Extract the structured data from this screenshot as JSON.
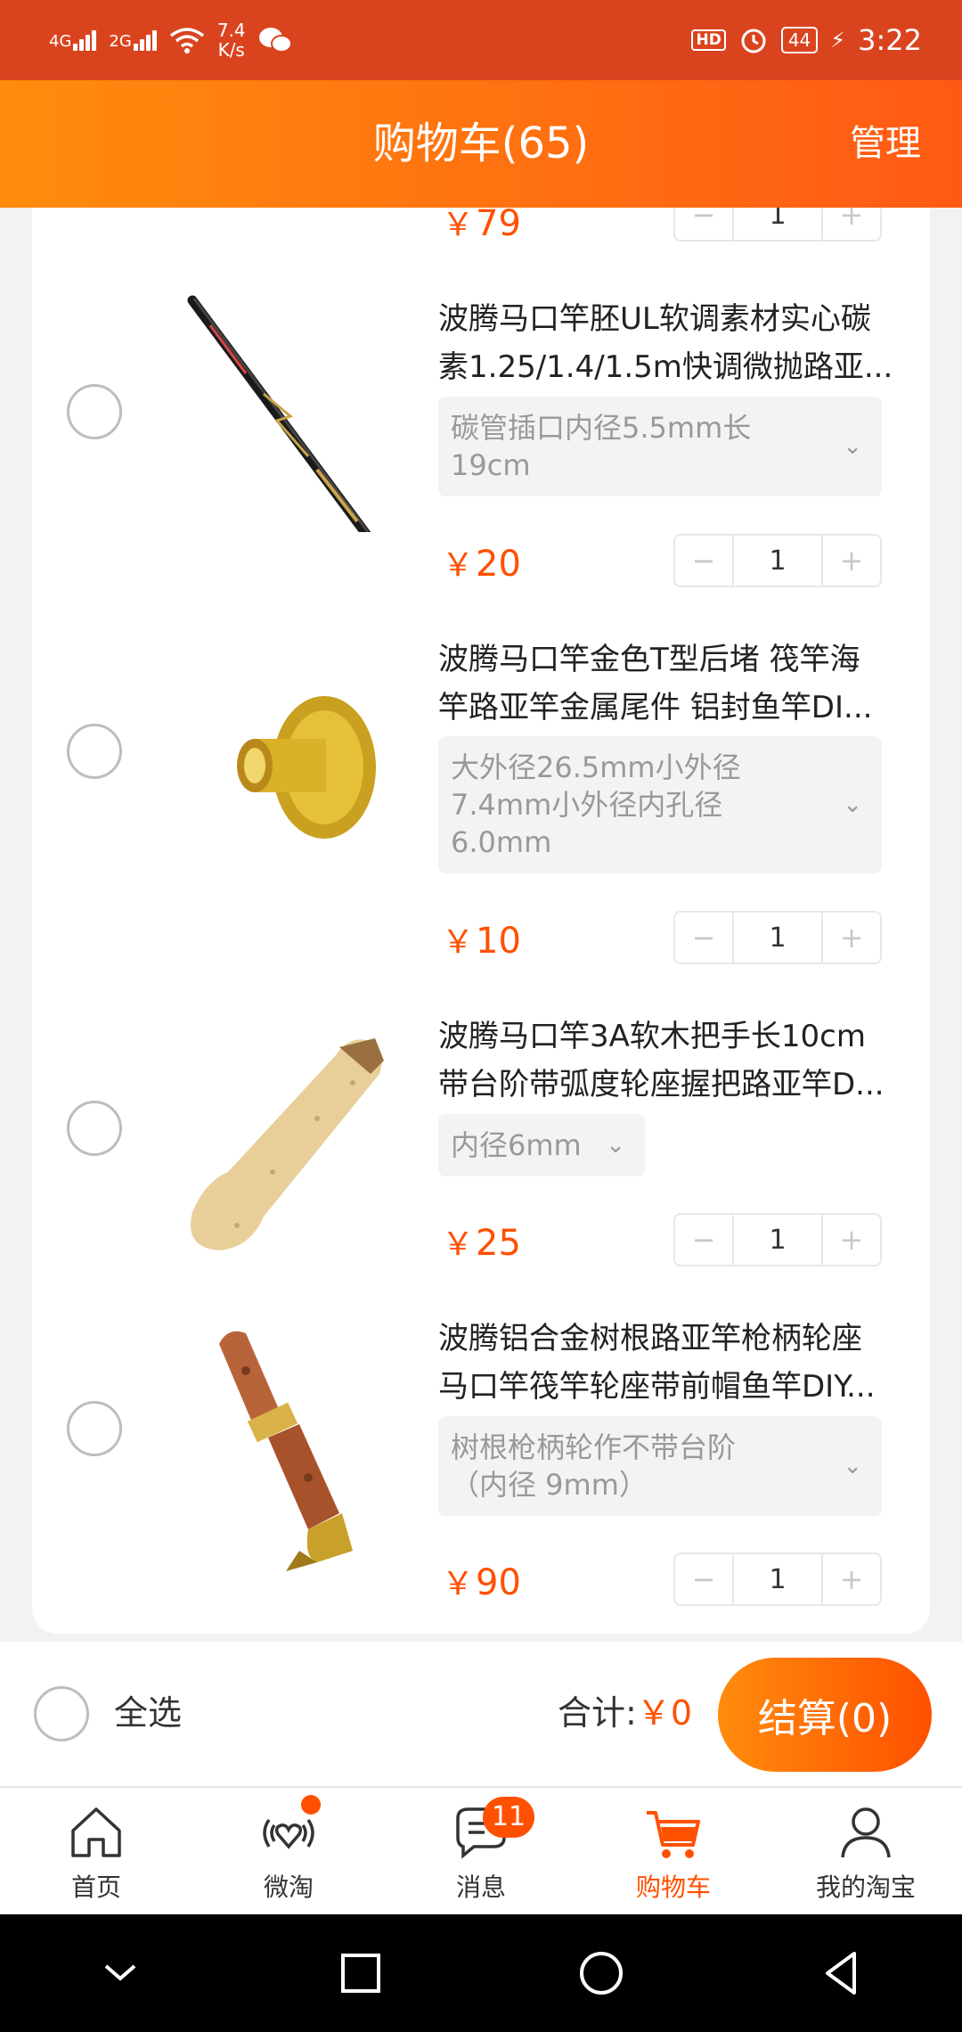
{
  "status_bar": {
    "network1": "4G",
    "network2": "2G",
    "speed_value": "7.4",
    "speed_unit": "K/s",
    "hd": "HD",
    "battery": "44",
    "time": "3:22"
  },
  "header": {
    "title": "购物车(65)",
    "manage": "管理"
  },
  "partial_item": {
    "price": "79",
    "qty": "1"
  },
  "currency": "￥",
  "stepper": {
    "minus": "−",
    "plus": "+"
  },
  "items": [
    {
      "title_line1": "波腾马口竿胚UL软调素材实心碳",
      "title_line2": "素1.25/1.4/1.5m快调微抛路亚...",
      "sku_line1": "碳管插口内径5.5mm长",
      "sku_line2": "19cm",
      "price": "20",
      "qty": "1"
    },
    {
      "title_line1": "波腾马口竿金色T型后堵 筏竿海",
      "title_line2": "竿路亚竿金属尾件 铝封鱼竿DI...",
      "sku_line1": "大外径26.5mm小外径",
      "sku_line2": "7.4mm小外径内孔径",
      "sku_line3": "6.0mm",
      "price": "10",
      "qty": "1"
    },
    {
      "title_line1": "波腾马口竿3A软木把手长10cm",
      "title_line2": "带台阶带弧度轮座握把路亚竿D...",
      "sku_line1": "内径6mm",
      "price": "25",
      "qty": "1"
    },
    {
      "title_line1": "波腾铝合金树根路亚竿枪柄轮座",
      "title_line2": "马口竿筏竿轮座带前帽鱼竿DIY...",
      "sku_line1": "树根枪柄轮作不带台阶",
      "sku_line2": "（内径 9mm）",
      "price": "90",
      "qty": "1"
    }
  ],
  "checkout": {
    "select_all": "全选",
    "total_label": "合计:",
    "total_amount": "￥0",
    "pay_button": "结算(0)"
  },
  "tabs": [
    {
      "label": "首页",
      "icon": "home-icon"
    },
    {
      "label": "微淘",
      "icon": "weitao-icon"
    },
    {
      "label": "消息",
      "icon": "message-icon",
      "badge": "11"
    },
    {
      "label": "购物车",
      "icon": "cart-icon",
      "active": true
    },
    {
      "label": "我的淘宝",
      "icon": "profile-icon"
    }
  ],
  "colors": {
    "accent": "#ff5000",
    "header_start": "#ff8c0d",
    "header_end": "#ff5a14",
    "status_bar": "#d9441f"
  }
}
